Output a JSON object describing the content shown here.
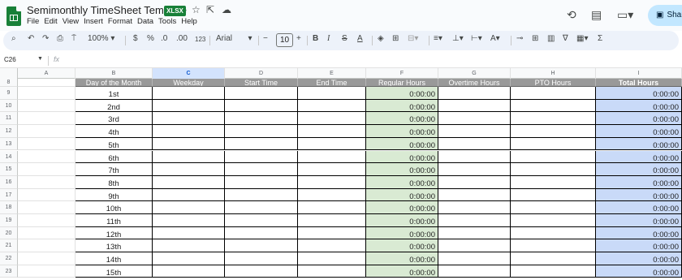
{
  "app": {
    "title": "Semimonthly TimeSheet Template",
    "badge": "XLSX",
    "menu": [
      "File",
      "Edit",
      "View",
      "Insert",
      "Format",
      "Data",
      "Tools",
      "Help"
    ],
    "share_label": "Share",
    "accent_color": "#188038",
    "share_color": "#c2e7ff"
  },
  "toolbar": {
    "zoom": "100%",
    "currency": "$",
    "percent": "%",
    "decrease_decimal": ".0",
    "increase_decimal": ".00",
    "number_format": "123",
    "font": "Arial",
    "font_size": "10",
    "icons": [
      "search-icon",
      "undo-icon",
      "redo-icon",
      "print-icon",
      "paint-format-icon",
      "bold-icon",
      "italic-icon",
      "strikethrough-icon",
      "text-color-icon",
      "fill-color-icon",
      "borders-icon",
      "merge-icon",
      "align-icon",
      "valign-icon",
      "wrap-icon",
      "rotate-icon",
      "link-icon",
      "comment-icon",
      "chart-icon",
      "filter-icon",
      "filter-views-icon",
      "functions-icon"
    ]
  },
  "formula_bar": {
    "cell_ref": "C26",
    "fx": "fx",
    "content": ""
  },
  "grid": {
    "columns": [
      "A",
      "B",
      "C",
      "D",
      "E",
      "F",
      "G",
      "H",
      "I"
    ],
    "selected_column": "C",
    "header_row": {
      "row_num": "8",
      "labels": [
        "",
        "Day of the Month",
        "Weekday",
        "Start Time",
        "End Time",
        "Regular Hours",
        "Overtime Hours",
        "PTO Hours",
        "Total Hours"
      ]
    },
    "rows": [
      {
        "num": "9",
        "day": "1st",
        "regular": "0:00:00",
        "total": "0:00:00"
      },
      {
        "num": "10",
        "day": "2nd",
        "regular": "0:00:00",
        "total": "0:00:00"
      },
      {
        "num": "11",
        "day": "3rd",
        "regular": "0:00:00",
        "total": "0:00:00"
      },
      {
        "num": "12",
        "day": "4th",
        "regular": "0:00:00",
        "total": "0:00:00"
      },
      {
        "num": "13",
        "day": "5th",
        "regular": "0:00:00",
        "total": "0:00:00"
      },
      {
        "num": "14",
        "day": "6th",
        "regular": "0:00:00",
        "total": "0:00:00"
      },
      {
        "num": "15",
        "day": "7th",
        "regular": "0:00:00",
        "total": "0:00:00"
      },
      {
        "num": "16",
        "day": "8th",
        "regular": "0:00:00",
        "total": "0:00:00"
      },
      {
        "num": "17",
        "day": "9th",
        "regular": "0:00:00",
        "total": "0:00:00"
      },
      {
        "num": "18",
        "day": "10th",
        "regular": "0:00:00",
        "total": "0:00:00"
      },
      {
        "num": "19",
        "day": "11th",
        "regular": "0:00:00",
        "total": "0:00:00"
      },
      {
        "num": "20",
        "day": "12th",
        "regular": "0:00:00",
        "total": "0:00:00"
      },
      {
        "num": "21",
        "day": "13th",
        "regular": "0:00:00",
        "total": "0:00:00"
      },
      {
        "num": "22",
        "day": "14th",
        "regular": "0:00:00",
        "total": "0:00:00"
      },
      {
        "num": "23",
        "day": "15th",
        "regular": "0:00:00",
        "total": "0:00:00"
      }
    ],
    "colors": {
      "header_bg": "#999999",
      "regular_hours_bg": "#d9ead3",
      "total_hours_bg": "#c9daf8",
      "selection": "#1a73e8"
    }
  }
}
